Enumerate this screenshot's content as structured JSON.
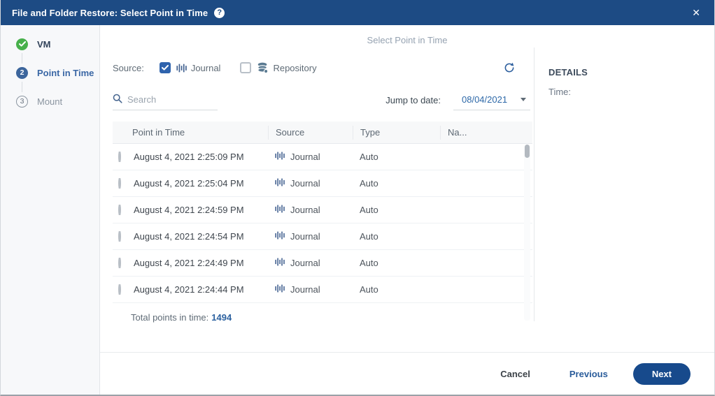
{
  "titlebar": {
    "title": "File and Folder Restore: Select Point in Time",
    "help_glyph": "?",
    "close_glyph": "✕"
  },
  "steps": [
    {
      "number": "",
      "label": "VM",
      "state": "complete"
    },
    {
      "number": "2",
      "label": "Point in Time",
      "state": "active"
    },
    {
      "number": "3",
      "label": "Mount",
      "state": "upcoming"
    }
  ],
  "main": {
    "heading": "Select Point in Time",
    "source_filter": {
      "label": "Source:",
      "options": [
        {
          "label": "Journal",
          "checked": true
        },
        {
          "label": "Repository",
          "checked": false
        }
      ]
    },
    "search": {
      "placeholder": "Search"
    },
    "jump_to_date": {
      "label": "Jump to date:",
      "value": "08/04/2021"
    },
    "table": {
      "columns": [
        "",
        "Point in Time",
        "Source",
        "Type",
        "Na..."
      ],
      "rows": [
        {
          "time": "August 4, 2021 2:25:09 PM",
          "source": "Journal",
          "type": "Auto",
          "name": "",
          "selected": false
        },
        {
          "time": "August 4, 2021 2:25:04 PM",
          "source": "Journal",
          "type": "Auto",
          "name": "",
          "selected": false
        },
        {
          "time": "August 4, 2021 2:24:59 PM",
          "source": "Journal",
          "type": "Auto",
          "name": "",
          "selected": false
        },
        {
          "time": "August 4, 2021 2:24:54 PM",
          "source": "Journal",
          "type": "Auto",
          "name": "",
          "selected": false
        },
        {
          "time": "August 4, 2021 2:24:49 PM",
          "source": "Journal",
          "type": "Auto",
          "name": "",
          "selected": false
        },
        {
          "time": "August 4, 2021 2:24:44 PM",
          "source": "Journal",
          "type": "Auto",
          "name": "",
          "selected": false
        }
      ]
    },
    "total": {
      "label": "Total points in time:",
      "value": "1494"
    }
  },
  "details": {
    "heading": "DETAILS",
    "fields": [
      {
        "label": "Time:",
        "value": ""
      }
    ]
  },
  "footer": {
    "cancel": "Cancel",
    "previous": "Previous",
    "next": "Next"
  },
  "colors": {
    "titlebar_blue": "#1d4b84",
    "accent_blue": "#2d62a0",
    "step_active_blue": "#3c659c",
    "complete_green": "#47b04b",
    "checkbox_blue": "#2f63ad",
    "journal_icon_blue": "#3f5e8e",
    "repository_icon_slate": "#5a7a91",
    "muted_text": "#5f6b76"
  }
}
